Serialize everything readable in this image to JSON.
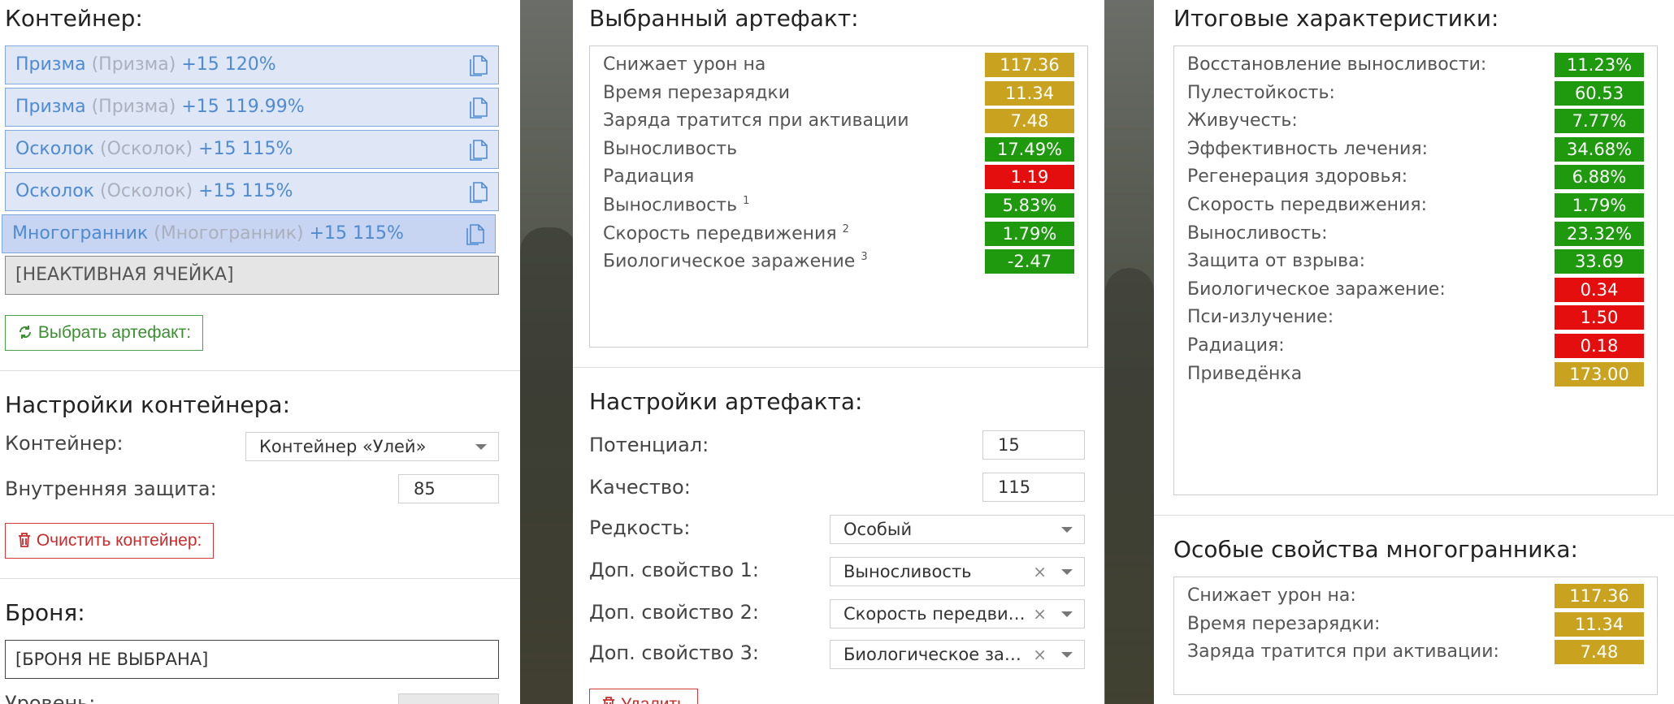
{
  "colors": {
    "gold": "#c9a31f",
    "green": "#1f9a0f",
    "red": "#e50e0e",
    "link_blue": "#4f8bd1"
  },
  "container": {
    "title": "Контейнер:",
    "slots": [
      {
        "name": "Призма",
        "alt": "(Призма)",
        "level": "+15 120%"
      },
      {
        "name": "Призма",
        "alt": "(Призма)",
        "level": "+15 119.99%"
      },
      {
        "name": "Осколок",
        "alt": "(Осколок)",
        "level": "+15 115%"
      },
      {
        "name": "Осколок",
        "alt": "(Осколок)",
        "level": "+15 115%"
      },
      {
        "name": "Многогранник",
        "alt": "(Многогранник)",
        "level": "+15 115%"
      }
    ],
    "inactive_cell": "[НЕАКТИВНАЯ ЯЧЕЙКА]",
    "choose_button": "Выбрать артефакт:"
  },
  "container_settings": {
    "title": "Настройки контейнера:",
    "container_label": "Контейнер:",
    "container_value": "Контейнер «Улей»",
    "inner_protection_label": "Внутренняя защита:",
    "inner_protection_value": "85",
    "clear_button": "Очистить контейнер:"
  },
  "armor": {
    "title": "Броня:",
    "value": "[БРОНЯ НЕ ВЫБРАНА]",
    "level_label": "Уровень:"
  },
  "selected_artifact": {
    "title": "Выбранный артефакт:",
    "rows": [
      {
        "label": "Снижает урон на",
        "sup": "",
        "value": "117.36",
        "color": "gold"
      },
      {
        "label": "Время перезарядки",
        "sup": "",
        "value": "11.34",
        "color": "gold"
      },
      {
        "label": "Заряда тратится при активации",
        "sup": "",
        "value": "7.48",
        "color": "gold"
      },
      {
        "label": "Выносливость",
        "sup": "",
        "value": "17.49%",
        "color": "green"
      },
      {
        "label": "Радиация",
        "sup": "",
        "value": "1.19",
        "color": "red"
      },
      {
        "label": "Выносливость",
        "sup": "1",
        "value": "5.83%",
        "color": "green"
      },
      {
        "label": "Скорость передвижения",
        "sup": "2",
        "value": "1.79%",
        "color": "green"
      },
      {
        "label": "Биологическое заражение",
        "sup": "3",
        "value": "-2.47",
        "color": "green"
      }
    ]
  },
  "artifact_settings": {
    "title": "Настройки артефакта:",
    "potential_label": "Потенциал:",
    "potential_value": "15",
    "quality_label": "Качество:",
    "quality_value": "115",
    "rarity_label": "Редкость:",
    "rarity_value": "Особый",
    "extra1_label": "Доп. свойство 1:",
    "extra1_value": "Выносливость",
    "extra2_label": "Доп. свойство 2:",
    "extra2_value": "Скорость передвижения",
    "extra3_label": "Доп. свойство 3:",
    "extra3_value": "Биологическое заражение",
    "clear_symbol": "×",
    "delete_button": "Удалить"
  },
  "totals": {
    "title": "Итоговые характеристики:",
    "rows": [
      {
        "label": "Восстановление выносливости:",
        "value": "11.23%",
        "color": "green"
      },
      {
        "label": "Пулестойкость:",
        "value": "60.53",
        "color": "green"
      },
      {
        "label": "Живучесть:",
        "value": "7.77%",
        "color": "green"
      },
      {
        "label": "Эффективность лечения:",
        "value": "34.68%",
        "color": "green"
      },
      {
        "label": "Регенерация здоровья:",
        "value": "6.88%",
        "color": "green"
      },
      {
        "label": "Скорость передвижения:",
        "value": "1.79%",
        "color": "green"
      },
      {
        "label": "Выносливость:",
        "value": "23.32%",
        "color": "green"
      },
      {
        "label": "Защита от взрыва:",
        "value": "33.69",
        "color": "green"
      },
      {
        "label": "Биологическое заражение:",
        "value": "0.34",
        "color": "red"
      },
      {
        "label": "Пси-излучение:",
        "value": "1.50",
        "color": "red"
      },
      {
        "label": "Радиация:",
        "value": "0.18",
        "color": "red"
      },
      {
        "label": "Приведёнка",
        "value": "173.00",
        "color": "gold"
      }
    ]
  },
  "special": {
    "title": "Особые свойства многогранника:",
    "rows": [
      {
        "label": "Снижает урон на:",
        "value": "117.36",
        "color": "gold"
      },
      {
        "label": "Время перезарядки:",
        "value": "11.34",
        "color": "gold"
      },
      {
        "label": "Заряда тратится при активации:",
        "value": "7.48",
        "color": "gold"
      }
    ]
  }
}
